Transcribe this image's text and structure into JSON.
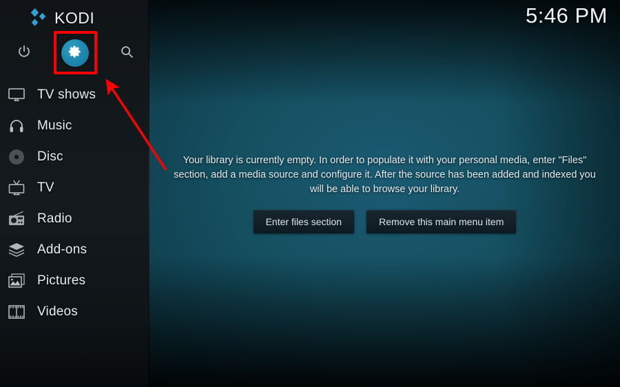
{
  "app": {
    "name": "KODI",
    "logo_icon": "kodi-diamond-logo"
  },
  "header": {
    "clock": "5:46 PM"
  },
  "colors": {
    "accent_teal": "#1d87ae",
    "highlight_red": "#fe0000",
    "sidebar_bg": "#12171a",
    "background_teal": "#155061",
    "text_primary": "#e9eef1",
    "button_bg": "#16242c"
  },
  "sidebar": {
    "top_actions": [
      {
        "name": "power",
        "label": "Power",
        "icon": "power-icon",
        "selected": false
      },
      {
        "name": "settings",
        "label": "Settings",
        "icon": "gear-icon",
        "selected": true
      },
      {
        "name": "search",
        "label": "Search",
        "icon": "search-icon",
        "selected": false
      }
    ],
    "items": [
      {
        "label": "TV shows",
        "icon": "tv-monitor-icon"
      },
      {
        "label": "Music",
        "icon": "headphones-icon"
      },
      {
        "label": "Disc",
        "icon": "disc-icon"
      },
      {
        "label": "TV",
        "icon": "television-antenna-icon"
      },
      {
        "label": "Radio",
        "icon": "radio-icon"
      },
      {
        "label": "Add-ons",
        "icon": "open-box-icon"
      },
      {
        "label": "Pictures",
        "icon": "pictures-stack-icon"
      },
      {
        "label": "Videos",
        "icon": "film-strip-icon"
      }
    ]
  },
  "main": {
    "empty_message": "Your library is currently empty. In order to populate it with your personal media, enter \"Files\" section, add a media source and configure it. After the source has been added and indexed you will be able to browse your library.",
    "buttons": [
      {
        "label": "Enter files section"
      },
      {
        "label": "Remove this main menu item"
      }
    ]
  },
  "annotation": {
    "arrow": "red-arrow-pointing-to-settings",
    "highlight": "red-box-around-settings-icon"
  }
}
